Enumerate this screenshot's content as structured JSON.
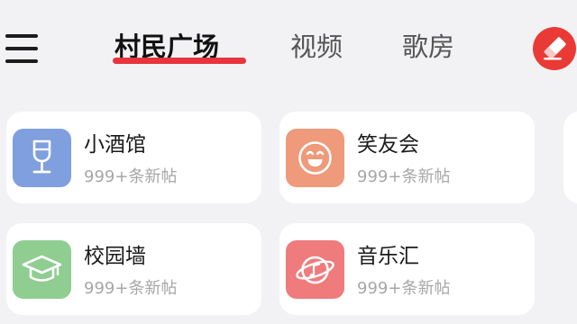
{
  "header": {
    "tabs": [
      {
        "label": "村民广场",
        "active": true
      },
      {
        "label": "视频",
        "active": false
      },
      {
        "label": "歌房",
        "active": false
      }
    ],
    "menu_icon": "hamburger-menu-icon",
    "edit_icon": "eraser-icon"
  },
  "colors": {
    "accent": "#e8343c",
    "background": "#f2f2f4"
  },
  "cards": [
    {
      "name": "小酒馆",
      "subtitle": "999+条新帖",
      "icon": "wine-glass-icon",
      "icon_color": "#7f9fdf"
    },
    {
      "name": "笑友会",
      "subtitle": "999+条新帖",
      "icon": "smiley-face-icon",
      "icon_color": "#ee9a7b"
    },
    {
      "name": "校园墙",
      "subtitle": "999+条新帖",
      "icon": "graduation-cap-icon",
      "icon_color": "#8fcd91"
    },
    {
      "name": "音乐汇",
      "subtitle": "999+条新帖",
      "icon": "music-planet-icon",
      "icon_color": "#ef7b7c"
    }
  ]
}
